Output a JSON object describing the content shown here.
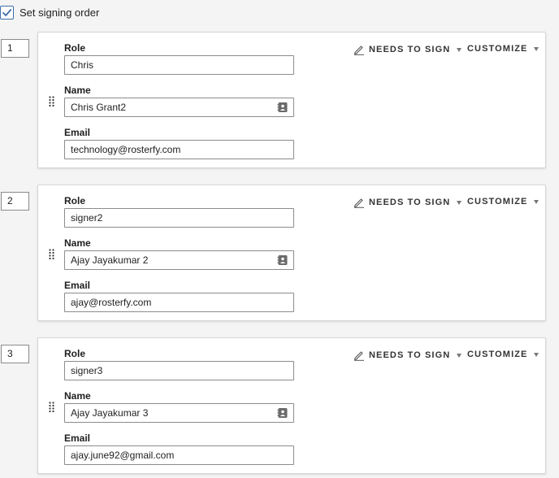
{
  "signing_order": {
    "label": "Set signing order",
    "checked": true
  },
  "role_label": "Role",
  "name_label": "Name",
  "email_label": "Email",
  "recipients": [
    {
      "order": "1",
      "role": "Chris",
      "name": "Chris Grant2",
      "email": "technology@rosterfy.com",
      "action": "NEEDS TO SIGN",
      "customize": "CUSTOMIZE"
    },
    {
      "order": "2",
      "role": "signer2",
      "name": "Ajay Jayakumar 2",
      "email": "ajay@rosterfy.com",
      "action": "NEEDS TO SIGN",
      "customize": "CUSTOMIZE"
    },
    {
      "order": "3",
      "role": "signer3",
      "name": "Ajay Jayakumar 3",
      "email": "ajay.june92@gmail.com",
      "action": "NEEDS TO SIGN",
      "customize": "CUSTOMIZE"
    }
  ],
  "colors": {
    "checkbox_accent": "#3f6fa8",
    "card_border": "#d6d6d6",
    "page_background": "#f4f4f4"
  },
  "icons": [
    "check-icon",
    "drag-handle-icon",
    "contact-card-icon",
    "pen-icon",
    "caret-down-icon"
  ]
}
